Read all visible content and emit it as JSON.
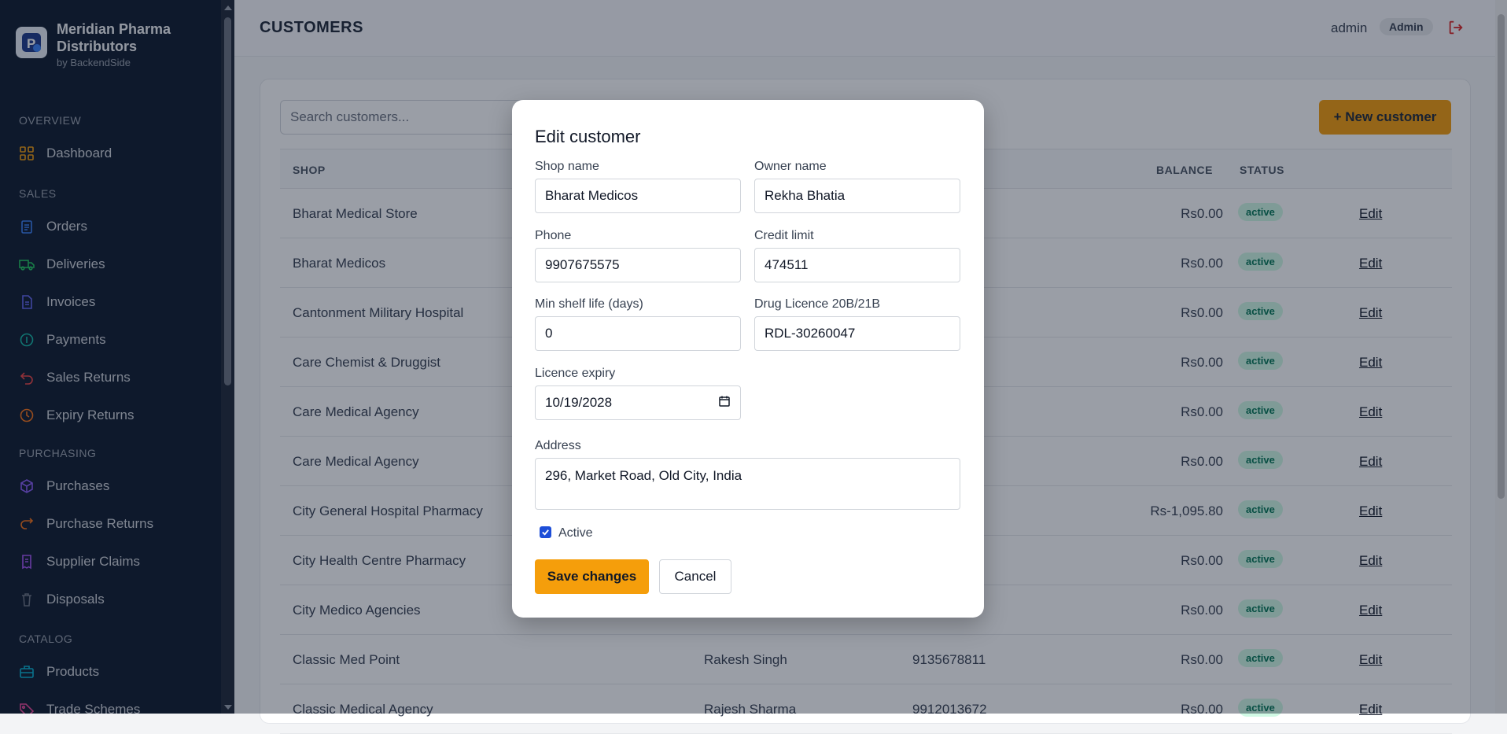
{
  "brand": {
    "name": "Meridian Pharma Distributors",
    "sub": "by BackendSide"
  },
  "sidebar": {
    "sections": [
      {
        "title": "OVERVIEW",
        "items": [
          {
            "label": "Dashboard",
            "icon": "grid-icon",
            "color": "#f59e0b"
          }
        ]
      },
      {
        "title": "SALES",
        "items": [
          {
            "label": "Orders",
            "icon": "clipboard-icon",
            "color": "#3b82f6"
          },
          {
            "label": "Deliveries",
            "icon": "truck-icon",
            "color": "#22c55e"
          },
          {
            "label": "Invoices",
            "icon": "document-icon",
            "color": "#6366f1"
          },
          {
            "label": "Payments",
            "icon": "coin-icon",
            "color": "#14b8a6"
          },
          {
            "label": "Sales Returns",
            "icon": "return-arrow-icon",
            "color": "#ef4444"
          },
          {
            "label": "Expiry Returns",
            "icon": "clock-icon",
            "color": "#f97316"
          }
        ]
      },
      {
        "title": "PURCHASING",
        "items": [
          {
            "label": "Purchases",
            "icon": "box-icon",
            "color": "#8b5cf6"
          },
          {
            "label": "Purchase Returns",
            "icon": "swap-arrow-icon",
            "color": "#f97316"
          },
          {
            "label": "Supplier Claims",
            "icon": "receipt-icon",
            "color": "#a855f7"
          },
          {
            "label": "Disposals",
            "icon": "trash-icon",
            "color": "#6b7280"
          }
        ]
      },
      {
        "title": "CATALOG",
        "items": [
          {
            "label": "Products",
            "icon": "briefcase-icon",
            "color": "#06b6d4"
          },
          {
            "label": "Trade Schemes",
            "icon": "tag-icon",
            "color": "#ec4899"
          }
        ]
      }
    ]
  },
  "header": {
    "title": "CUSTOMERS",
    "user": "admin",
    "role": "Admin",
    "logout_color": "#dc2626"
  },
  "toolbar": {
    "search_placeholder": "Search customers...",
    "new_label": "+ New customer"
  },
  "table": {
    "columns": {
      "shop": "SHOP",
      "balance": "BALANCE",
      "status": "STATUS"
    },
    "rows": [
      {
        "shop": "Bharat Medical Store",
        "owner": "",
        "phone": "",
        "balance": "Rs0.00",
        "status": "active",
        "action": "Edit"
      },
      {
        "shop": "Bharat Medicos",
        "owner": "",
        "phone": "",
        "balance": "Rs0.00",
        "status": "active",
        "action": "Edit"
      },
      {
        "shop": "Cantonment Military Hospital",
        "owner": "",
        "phone": "",
        "balance": "Rs0.00",
        "status": "active",
        "action": "Edit"
      },
      {
        "shop": "Care Chemist & Druggist",
        "owner": "",
        "phone": "",
        "balance": "Rs0.00",
        "status": "active",
        "action": "Edit"
      },
      {
        "shop": "Care Medical Agency",
        "owner": "",
        "phone": "",
        "balance": "Rs0.00",
        "status": "active",
        "action": "Edit"
      },
      {
        "shop": "Care Medical Agency",
        "owner": "",
        "phone": "",
        "balance": "Rs0.00",
        "status": "active",
        "action": "Edit"
      },
      {
        "shop": "City General Hospital Pharmacy",
        "owner": "",
        "phone": "",
        "balance": "Rs-1,095.80",
        "status": "active",
        "action": "Edit"
      },
      {
        "shop": "City Health Centre Pharmacy",
        "owner": "",
        "phone": "",
        "balance": "Rs0.00",
        "status": "active",
        "action": "Edit"
      },
      {
        "shop": "City Medico Agencies",
        "owner": "",
        "phone": "",
        "balance": "Rs0.00",
        "status": "active",
        "action": "Edit"
      },
      {
        "shop": "Classic Med Point",
        "owner": "Rakesh Singh",
        "phone": "9135678811",
        "balance": "Rs0.00",
        "status": "active",
        "action": "Edit"
      },
      {
        "shop": "Classic Medical Agency",
        "owner": "Rajesh Sharma",
        "phone": "9912013672",
        "balance": "Rs0.00",
        "status": "active",
        "action": "Edit"
      }
    ]
  },
  "modal": {
    "title": "Edit customer",
    "shop_name_label": "Shop name",
    "shop_name": "Bharat Medicos",
    "owner_name_label": "Owner name",
    "owner_name": "Rekha Bhatia",
    "phone_label": "Phone",
    "phone": "9907675575",
    "credit_limit_label": "Credit limit",
    "credit_limit": "474511",
    "min_shelf_label": "Min shelf life (days)",
    "min_shelf": "0",
    "licence_label": "Drug Licence 20B/21B",
    "licence": "RDL-30260047",
    "expiry_label": "Licence expiry",
    "expiry": "10/19/2028",
    "address_label": "Address",
    "address": "296, Market Road, Old City, India",
    "active_label": "Active",
    "active": true,
    "save_label": "Save changes",
    "cancel_label": "Cancel"
  }
}
